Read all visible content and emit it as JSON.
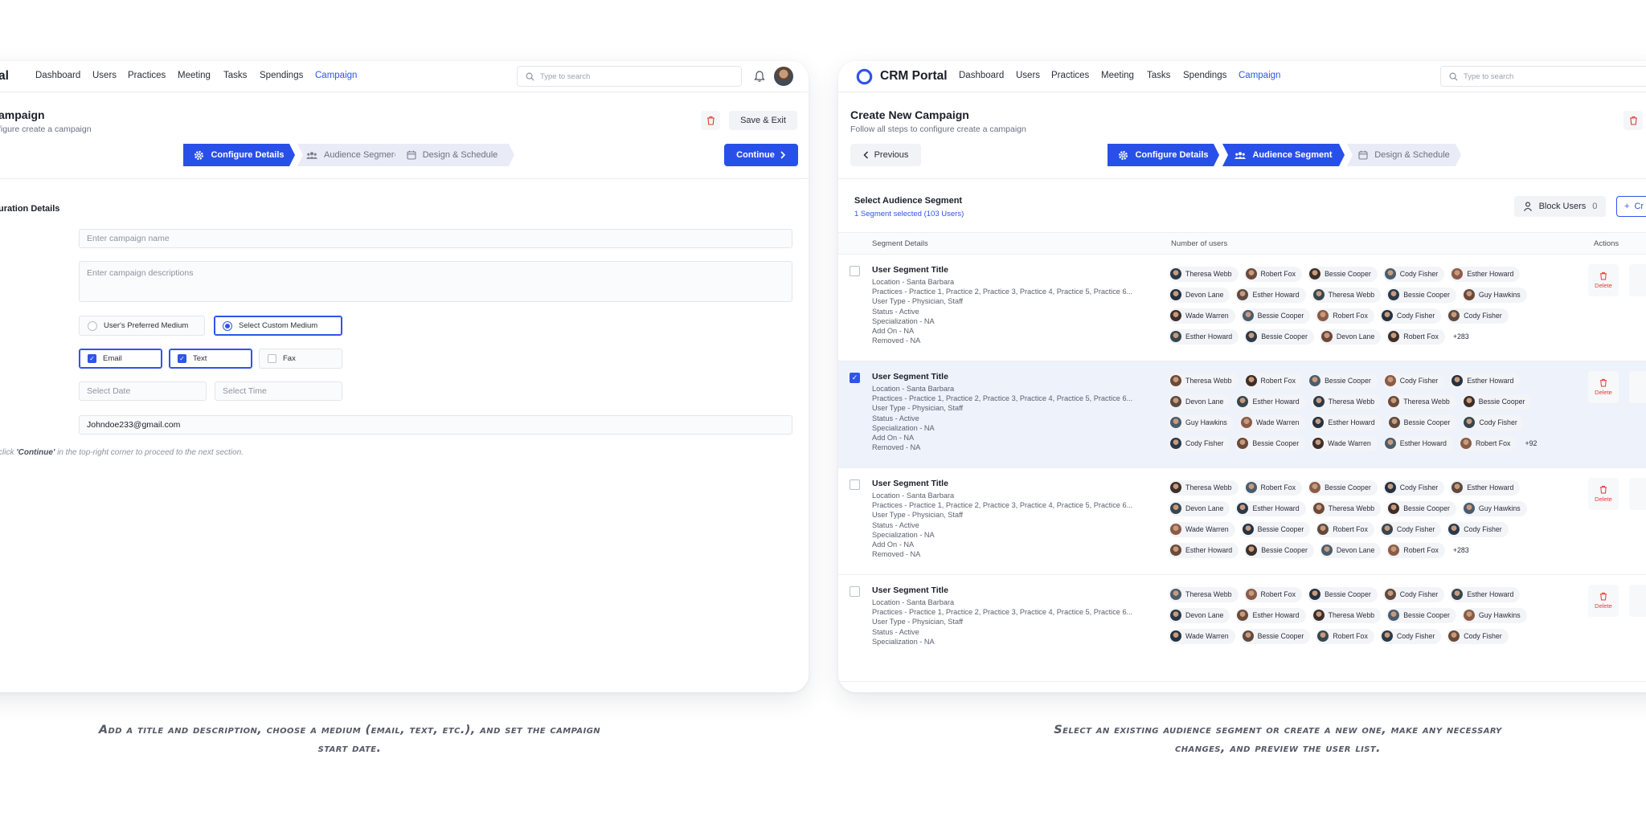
{
  "colors": {
    "accent": "#2850e8",
    "danger": "#e53935"
  },
  "left": {
    "brand": "al",
    "nav": [
      "Dashboard",
      "Users",
      "Practices",
      "Meeting",
      "Tasks",
      "Spendings",
      "Campaign"
    ],
    "search_placeholder": "Type to search",
    "title": "ampaign",
    "subtitle": "figure create a campaign",
    "save_exit": "Save & Exit",
    "steps": [
      "Configure Details",
      "Audience Segment",
      "Design & Schedule"
    ],
    "continue": "Continue",
    "section_title": "uration Details",
    "campaign_name_placeholder": "Enter campaign name",
    "campaign_desc_placeholder": "Enter campaign descriptions",
    "medium_options": [
      "User's Preferred Medium",
      "Select Custom Medium"
    ],
    "medium_selected": "Select Custom Medium",
    "channels": [
      {
        "label": "Email",
        "checked": true
      },
      {
        "label": "Text",
        "checked": true
      },
      {
        "label": "Fax",
        "checked": false
      }
    ],
    "date_placeholder": "Select Date",
    "time_placeholder": "Select Time",
    "email_value": "Johndoe233@gmail.com",
    "note_pre": "click ",
    "note_bold": "'Continue'",
    "note_post": " in the top-right corner to proceed to the next section."
  },
  "right": {
    "brand": "CRM Portal",
    "nav": [
      "Dashboard",
      "Users",
      "Practices",
      "Meeting",
      "Tasks",
      "Spendings",
      "Campaign"
    ],
    "search_placeholder": "Type to search",
    "title": "Create New Campaign",
    "subtitle": "Follow all steps to configure create a campaign",
    "previous": "Previous",
    "steps": [
      "Configure Details",
      "Audience Segment",
      "Design & Schedule"
    ],
    "select_title": "Select Audience Segment",
    "select_sub": "1 Segment selected (103 Users)",
    "block_users": "Block Users",
    "block_count": "0",
    "create_label": "Cr",
    "columns": [
      "Segment Details",
      "Number of users",
      "Actions"
    ],
    "delete_label": "Delete",
    "segments": [
      {
        "title": "User Segment Title",
        "selected": false,
        "lines": [
          "Location  - Santa Barbara",
          "Practices - Practice 1, Practice 2, Practice 3, Practice 4, Practice 5, Practice 6...",
          "User Type - Physician, Staff",
          "Status - Active",
          "Specialization -  NA",
          "Add On - NA",
          "Removed - NA"
        ],
        "users": [
          [
            "Theresa Webb",
            "Robert Fox",
            "Bessie Cooper",
            "Cody Fisher",
            "Esther Howard"
          ],
          [
            "Devon Lane",
            "Esther Howard",
            "Theresa Webb",
            "Bessie Cooper",
            "Guy Hawkins"
          ],
          [
            "Wade Warren",
            "Bessie Cooper",
            "Robert Fox",
            "Cody Fisher",
            "Cody Fisher"
          ],
          [
            "Esther Howard",
            "Bessie Cooper",
            "Devon Lane",
            "Robert Fox"
          ]
        ],
        "more": "+283"
      },
      {
        "title": "User Segment Title",
        "selected": true,
        "lines": [
          "Location  - Santa Barbara",
          "Practices - Practice 1, Practice 2, Practice 3, Practice 4, Practice 5, Practice 6...",
          "User Type - Physician, Staff",
          "Status - Active",
          "Specialization -  NA",
          "Add On - NA",
          "Removed - NA"
        ],
        "users": [
          [
            "Theresa Webb",
            "Robert Fox",
            "Bessie Cooper",
            "Cody Fisher",
            "Esther Howard"
          ],
          [
            "Devon Lane",
            "Esther Howard",
            "Theresa Webb",
            "Theresa Webb",
            "Bessie Cooper"
          ],
          [
            "Guy Hawkins",
            "Wade Warren",
            "Esther Howard",
            "Bessie Cooper",
            "Cody Fisher"
          ],
          [
            "Cody Fisher",
            "Bessie Cooper",
            "Wade Warren",
            "Esther Howard",
            "Robert Fox"
          ]
        ],
        "more": "+92"
      },
      {
        "title": "User Segment Title",
        "selected": false,
        "lines": [
          "Location  - Santa Barbara",
          "Practices - Practice 1, Practice 2, Practice 3, Practice 4, Practice 5, Practice 6...",
          "User Type - Physician, Staff",
          "Status - Active",
          "Specialization -  NA",
          "Add On - NA",
          "Removed - NA"
        ],
        "users": [
          [
            "Theresa Webb",
            "Robert Fox",
            "Bessie Cooper",
            "Cody Fisher",
            "Esther Howard"
          ],
          [
            "Devon Lane",
            "Esther Howard",
            "Theresa Webb",
            "Bessie Cooper",
            "Guy Hawkins"
          ],
          [
            "Wade Warren",
            "Bessie Cooper",
            "Robert Fox",
            "Cody Fisher",
            "Cody Fisher"
          ],
          [
            "Esther Howard",
            "Bessie Cooper",
            "Devon Lane",
            "Robert Fox"
          ]
        ],
        "more": "+283"
      },
      {
        "title": "User Segment Title",
        "selected": false,
        "lines": [
          "Location  - Santa Barbara",
          "Practices - Practice 1, Practice 2, Practice 3, Practice 4, Practice 5, Practice 6...",
          "User Type - Physician, Staff",
          "Status - Active",
          "Specialization -  NA"
        ],
        "users": [
          [
            "Theresa Webb",
            "Robert Fox",
            "Bessie Cooper",
            "Cody Fisher",
            "Esther Howard"
          ],
          [
            "Devon Lane",
            "Esther Howard",
            "Theresa Webb",
            "Bessie Cooper",
            "Guy Hawkins"
          ],
          [
            "Wade Warren",
            "Bessie Cooper",
            "Robert Fox",
            "Cody Fisher",
            "Cody Fisher"
          ]
        ],
        "more": ""
      }
    ]
  },
  "captions": {
    "left": "Add a title and description, choose a medium (email, text, etc.), and set the campaign start date.",
    "right": "Select an existing audience segment or create a new one, make any necessary changes, and preview the user list."
  }
}
